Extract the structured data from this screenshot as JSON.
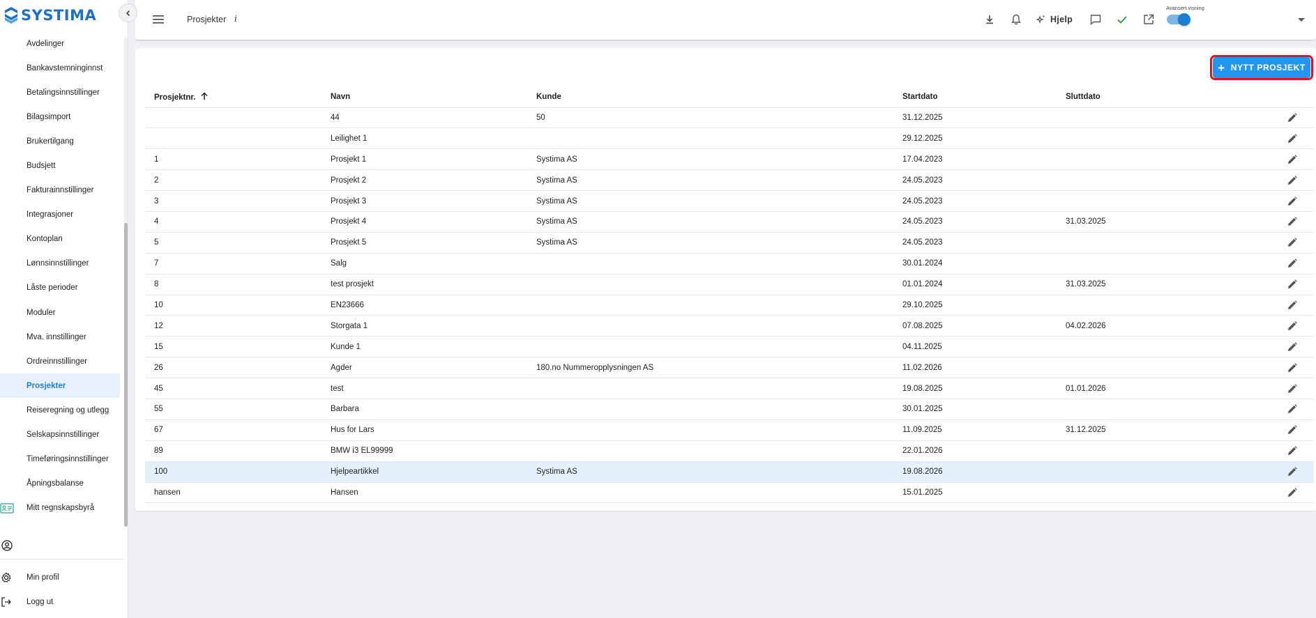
{
  "app": {
    "logo_text": "SYSTIMA",
    "brand_color": "#1e6fc6",
    "accent_color": "#2196f3"
  },
  "sidebar": {
    "collapse_icon": "chevron-left-icon",
    "items": [
      {
        "label": "Avdelinger"
      },
      {
        "label": "Bankavstemninginnst"
      },
      {
        "label": "Betalingsinnstillinger"
      },
      {
        "label": "Bilagsimport"
      },
      {
        "label": "Brukertilgang"
      },
      {
        "label": "Budsjett"
      },
      {
        "label": "Fakturainnstillinger"
      },
      {
        "label": "Integrasjoner"
      },
      {
        "label": "Kontoplan"
      },
      {
        "label": "Lønnsinnstillinger"
      },
      {
        "label": "Låste perioder"
      },
      {
        "label": "Moduler"
      },
      {
        "label": "Mva. innstillinger"
      },
      {
        "label": "Ordreinnstillinger"
      },
      {
        "label": "Prosjekter",
        "active": true
      },
      {
        "label": "Reiseregning og utlegg"
      },
      {
        "label": "Selskapsinnstillinger"
      },
      {
        "label": "Timeføringsinnstillinger"
      },
      {
        "label": "Åpningsbalanse"
      },
      {
        "label": "Mitt regnskapsbyrå",
        "icon": "id-card-icon"
      }
    ],
    "bottom": {
      "profile_label": "Min profil",
      "logout_label": "Logg ut"
    }
  },
  "header": {
    "title": "Prosjekter",
    "info_glyph": "i",
    "help_label": "Hjelp",
    "toggle_label": "Avansert visning",
    "toggle_on": true,
    "icons": [
      "menu-icon",
      "download-icon",
      "bell-icon",
      "sparkle-icon",
      "chat-icon",
      "check-icon",
      "external-link-icon",
      "chevron-down-icon"
    ]
  },
  "main": {
    "new_button_label": "NYTT PROSJEKT",
    "columns": {
      "nr": "Prosjektnr.",
      "navn": "Navn",
      "kunde": "Kunde",
      "start": "Startdato",
      "slutt": "Sluttdato"
    },
    "rows": [
      {
        "nr": "",
        "navn": "44",
        "kunde": "50",
        "start": "31.12.2025",
        "slutt": ""
      },
      {
        "nr": "",
        "navn": "Leilighet 1",
        "kunde": "",
        "start": "29.12.2025",
        "slutt": ""
      },
      {
        "nr": "1",
        "navn": "Prosjekt 1",
        "kunde": "Systima AS",
        "start": "17.04.2023",
        "slutt": ""
      },
      {
        "nr": "2",
        "navn": "Prosjekt 2",
        "kunde": "Systima AS",
        "start": "24.05.2023",
        "slutt": ""
      },
      {
        "nr": "3",
        "navn": "Prosjekt 3",
        "kunde": "Systima AS",
        "start": "24.05.2023",
        "slutt": ""
      },
      {
        "nr": "4",
        "navn": "Prosjekt 4",
        "kunde": "Systima AS",
        "start": "24.05.2023",
        "slutt": "31.03.2025"
      },
      {
        "nr": "5",
        "navn": "Prosjekt 5",
        "kunde": "Systima AS",
        "start": "24.05.2023",
        "slutt": ""
      },
      {
        "nr": "7",
        "navn": "Salg",
        "kunde": "",
        "start": "30.01.2024",
        "slutt": ""
      },
      {
        "nr": "8",
        "navn": "test prosjekt",
        "kunde": "",
        "start": "01.01.2024",
        "slutt": "31.03.2025"
      },
      {
        "nr": "10",
        "navn": "EN23666",
        "kunde": "",
        "start": "29.10.2025",
        "slutt": ""
      },
      {
        "nr": "12",
        "navn": "Storgata 1",
        "kunde": "",
        "start": "07.08.2025",
        "slutt": "04.02.2026"
      },
      {
        "nr": "15",
        "navn": "Kunde 1",
        "kunde": "",
        "start": "04.11.2025",
        "slutt": ""
      },
      {
        "nr": "26",
        "navn": "Agder",
        "kunde": "180.no Nummeropplysningen AS",
        "start": "11.02.2026",
        "slutt": ""
      },
      {
        "nr": "45",
        "navn": "test",
        "kunde": "",
        "start": "19.08.2025",
        "slutt": "01.01.2026"
      },
      {
        "nr": "55",
        "navn": "Barbara",
        "kunde": "",
        "start": "30.01.2025",
        "slutt": ""
      },
      {
        "nr": "67",
        "navn": "Hus for Lars",
        "kunde": "",
        "start": "11.09.2025",
        "slutt": "31.12.2025"
      },
      {
        "nr": "89",
        "navn": "BMW i3 EL99999",
        "kunde": "",
        "start": "22.01.2026",
        "slutt": ""
      },
      {
        "nr": "100",
        "navn": "Hjelpeartikkel",
        "kunde": "Systima AS",
        "start": "19.08.2026",
        "slutt": "",
        "highlighted": true
      },
      {
        "nr": "hansen",
        "navn": "Hansen",
        "kunde": "",
        "start": "15.01.2025",
        "slutt": ""
      }
    ]
  }
}
